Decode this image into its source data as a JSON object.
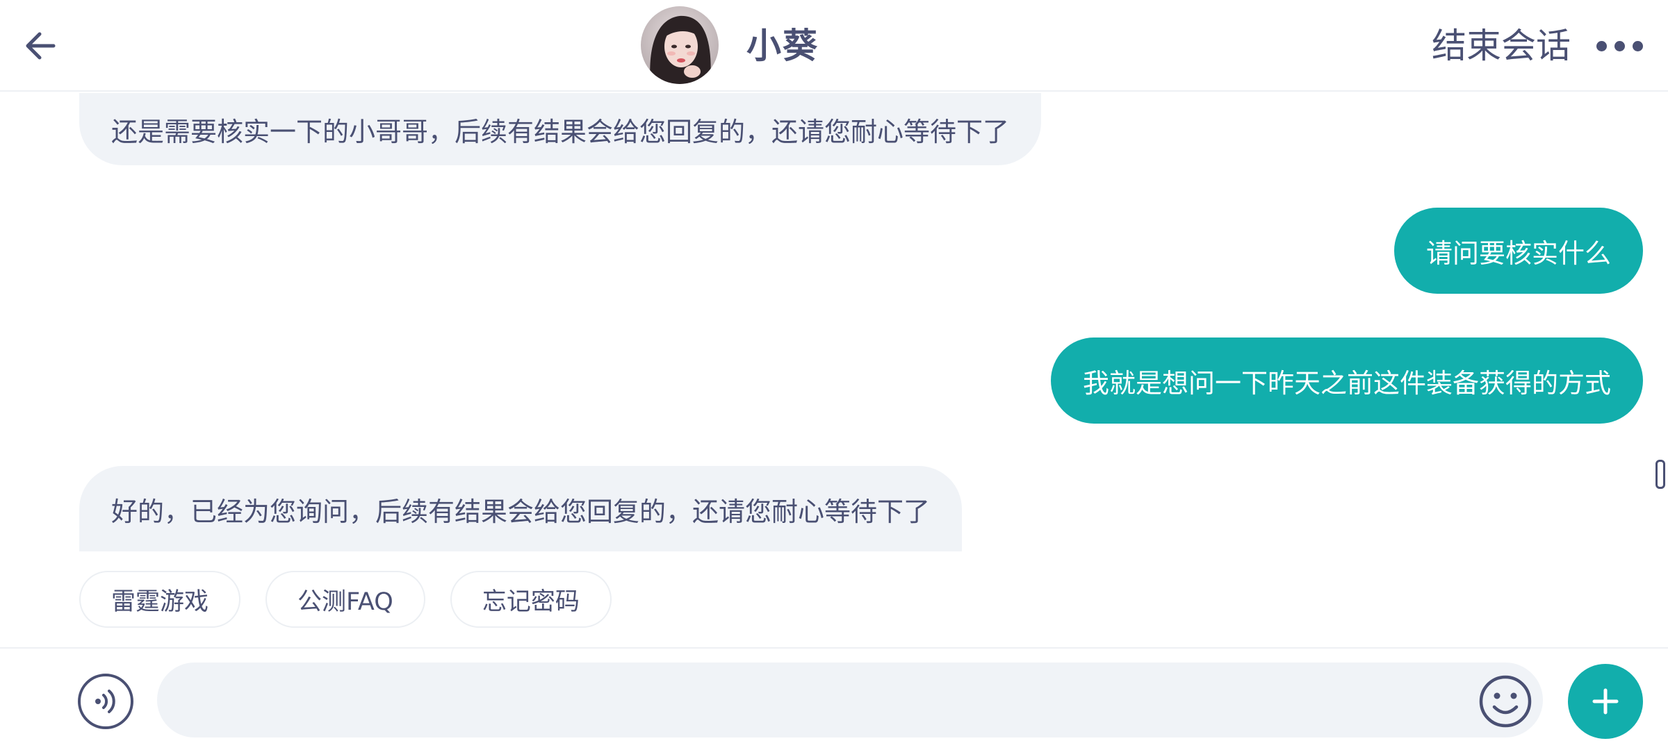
{
  "header": {
    "back_icon": "arrow-left-icon",
    "avatar_alt": "avatar",
    "title": "小葵",
    "end_session_label": "结束会话",
    "more_icon": "more-horizontal-icon"
  },
  "messages": [
    {
      "side": "left",
      "text": "还是需要核实一下的小哥哥，后续有结果会给您回复的，还请您耐心等待下了"
    },
    {
      "side": "right",
      "text": "请问要核实什么"
    },
    {
      "side": "right",
      "text": "我就是想问一下昨天之前这件装备获得的方式"
    },
    {
      "side": "left",
      "text": "好的，已经为您询问，后续有结果会给您回复的，还请您耐心等待下了"
    }
  ],
  "quick_replies": [
    "雷霆游戏",
    "公测FAQ",
    "忘记密码"
  ],
  "input": {
    "value": "",
    "placeholder": "",
    "voice_icon": "voice-icon",
    "emoji_icon": "emoji-icon",
    "plus_icon": "plus-icon"
  },
  "colors": {
    "accent": "#12aeac",
    "text": "#4a5073",
    "bubble_left": "#f0f3f7"
  }
}
